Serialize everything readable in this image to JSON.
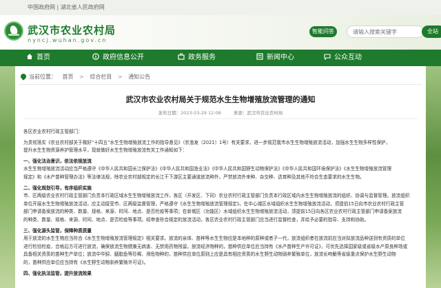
{
  "topbar": {
    "links": "中国政府网 | 湖北省人民政府网"
  },
  "header": {
    "title": "武汉市农业农村局",
    "domain": "nyncj.wuhan.gov.cn",
    "smart_button": "智能问答",
    "search_placeholder": "请输入搜索关键字",
    "search_button": "全站"
  },
  "nav": {
    "items": [
      {
        "label": "首页",
        "icon": "home-icon"
      },
      {
        "label": "政府信息公开",
        "icon": "info-icon"
      },
      {
        "label": "政务服务",
        "icon": "service-icon"
      },
      {
        "label": "新闻中心",
        "icon": "news-icon"
      },
      {
        "label": "公众互动",
        "icon": "chat-icon"
      }
    ]
  },
  "breadcrumb": {
    "label": "当前位置：",
    "items": [
      "首页",
      "综合栏目",
      "通知公告"
    ],
    "separator": ">"
  },
  "article": {
    "title": "武汉市农业农村局关于规范水生生物增殖放流管理的通知",
    "date": "发布日期：2023-03-29 12:08",
    "source": "来源：武汉市农业农村局",
    "salutation": "各区农业农村行政主管部门：",
    "intro": [
      "为贯彻落实《农业农村部关于做好“十四五”水生生物增殖放流工作的指导意见》（农渔发〔2021〕1号）有关要求，进一步规范我市水生生物增殖放流活动，加强水生生物多样性保护，",
      "提升水生生物资源养护管理水平，现就做好水生生物增殖放流有关工作通知如下："
    ],
    "sections": [
      {
        "heading": "一、强化法治意识，依法依规放流",
        "lines": [
          "水生生物增殖放流活动应当严格遵守《中华人民共和国长江保护法》《中华人民共和国渔业法》《中华人民共和国野生动物保护法》《中华人民共和国环境保护法》《水生生物增殖放流管理",
          "规定》和《水产苗种管理办法》等法律法规，除农业农村部规定的长江干下游区主要通道放流种外，严禁放流外来种、杂交种、选育种及其他不符合生态要求的水生生物。"
        ]
      },
      {
        "heading": "二、强化规划引导，有序组织实施",
        "lines": [
          "市、区两级农业农村行政主管部门负责本行政区域水生生物增殖放流工作，各区（开发区、下同）农业农村行政主管部门负责本行政区域内水生生物增殖放流的组织、协调与监督管理。放流组织",
          "单位开展水生生物增殖放流活动，应主动接受市、区两级监督管理，严格遵守《水生生物增殖放流管理规定》。在中心城区水域组织水生生物增殖放流活动，须提前15日向市农业农村行政主管",
          "部门申请备案放流的种类、数量、规格、来源、时间、地点、是否检疫等事项；在新城区（功能区）水域组织水生生物增殖放流活动，须提前15日向各区农业农村行政主管部门申请备案放流",
          "的种类、数量、规格、来源、时间、地点、是否检疫等事项。经审查符合规定的放流活动，各区农业农村行政主管部门应当进行监督检查，并给予必要的指导、支持和协助。"
        ]
      },
      {
        "heading": "三、强化源头监管，保障种质质量",
        "lines": [
          "用于放流的水生生物应当符合《水生生物增殖放流管理规定》相关要求。放流的亲体、苗种等水生生物应是本地种的原种或者子一代，放流组织者在放流前应当对拟放流品种送到有资质的单位",
          "进行检验检疫，合格后方可进行放流，确保放流生物健康无病害、无禁用药物残留。放流经济物种的，苗种供应单位应当持有《水产苗种生产许可证》，可优先选择国家级或省级水产原良种场或",
          "具备相关资质的苗种生产单位；放流中华鲟、胭脂鱼等珍稀、濒危物种的，苗种供应单位原则上应是具有相应资质的水生野生动物驯养繁殖单位，放流长吻鮠等省级重点保护水生野生动物",
          "的，苗种供应单位应当持有《水生野生动物驯养繁殖许可证》。"
        ]
      },
      {
        "heading": "四、强化执法监管，提升放流效果",
        "lines": []
      }
    ]
  }
}
